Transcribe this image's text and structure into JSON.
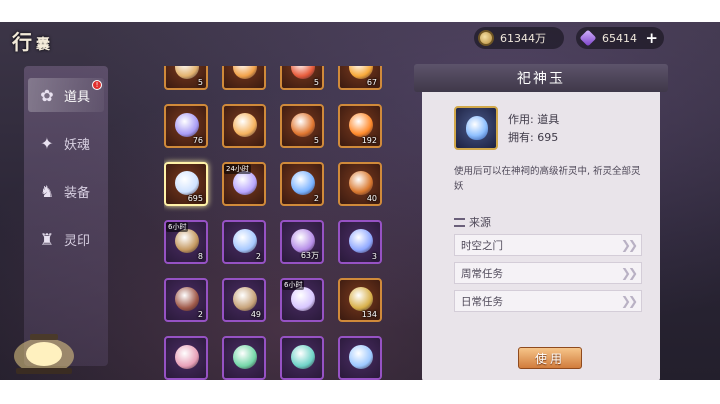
{
  "header": {
    "bag_title_main": "行",
    "bag_title_small": "囊",
    "coins": "61344万",
    "gems": "65414",
    "coin_icon": "coin-icon",
    "gem_icon": "jade-gem-icon"
  },
  "sidebar": {
    "items": [
      {
        "label": "道具",
        "icon": "item-bag-icon",
        "active": true
      },
      {
        "label": "妖魂",
        "icon": "spirit-icon",
        "active": false
      },
      {
        "label": "装备",
        "icon": "equipment-icon",
        "active": false
      },
      {
        "label": "灵印",
        "icon": "seal-icon",
        "active": false
      }
    ],
    "badge": "!"
  },
  "grid": {
    "rows": [
      [
        {
          "count": "5"
        },
        {
          "count": ""
        },
        {
          "count": "5"
        },
        {
          "count": "67"
        }
      ],
      [
        {
          "count": "76"
        },
        {
          "count": ""
        },
        {
          "count": "5"
        },
        {
          "count": "192"
        }
      ],
      [
        {
          "count": "695",
          "selected": true
        },
        {
          "count": "",
          "timer": "24小时"
        },
        {
          "count": "2"
        },
        {
          "count": "40"
        }
      ],
      [
        {
          "count": "8",
          "timer": "6小时"
        },
        {
          "count": "2"
        },
        {
          "count": "63万"
        },
        {
          "count": "3"
        }
      ],
      [
        {
          "count": "2"
        },
        {
          "count": "49"
        },
        {
          "count": "",
          "timer": "6小时"
        },
        {
          "count": "134"
        }
      ],
      [
        {
          "count": ""
        },
        {
          "count": ""
        },
        {
          "count": ""
        },
        {
          "count": ""
        }
      ]
    ]
  },
  "detail": {
    "title": "祀神玉",
    "usage": "作用: 道具",
    "owned": "拥有: 695",
    "description": "使用后可以在神祠的高级祈灵中, 祈灵全部灵妖",
    "source_label": "来源",
    "sources": [
      "时空之门",
      "周常任务",
      "日常任务"
    ],
    "use_label": "使用"
  }
}
